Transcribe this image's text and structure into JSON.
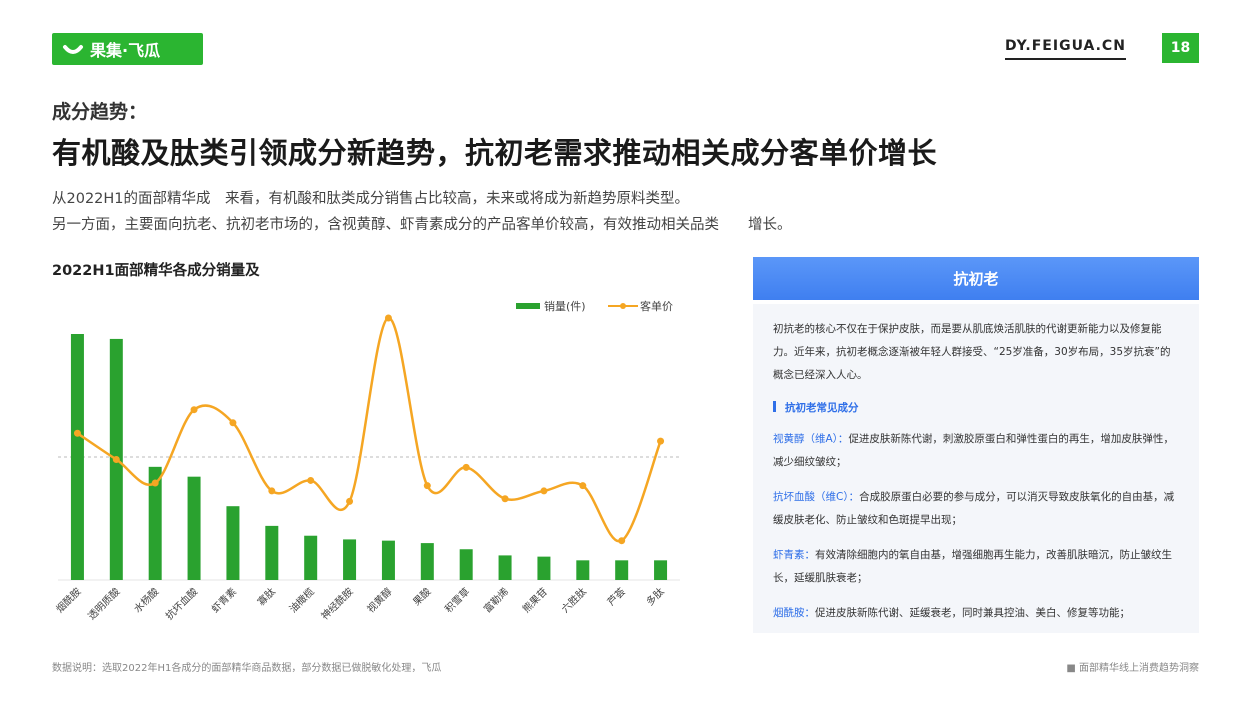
{
  "header": {
    "logo_text": "果集·飞瓜",
    "site": "DY.FEIGUA.CN",
    "page_number": "18"
  },
  "kicker": "成分趋势：",
  "headline": "有机酸及肽类引领成分新趋势，抗初老需求推动相关成分客单价增长",
  "description": [
    "从2022H1的面部精华成　来看，有机酸和肽类成分销售占比较高，未来或将成为新趋势原料类型。",
    "另一方面，主要面向抗老、抗初老市场的，含视黄醇、虾青素成分的产品客单价较高，有效推动相关品类　　增长。"
  ],
  "chart_data": {
    "type": "bar",
    "title": "2022H1面部精华各成分销量及",
    "categories": [
      "烟酰胺",
      "透明质酸",
      "水杨酸",
      "抗坏血酸",
      "虾青素",
      "寡肽",
      "油橄榄",
      "神经酰胺",
      "视黄醇",
      "果酸",
      "积雪草",
      "富勒烯",
      "熊果苷",
      "六胜肽",
      "芦荟",
      "多肽"
    ],
    "series": [
      {
        "name": "销量(件)",
        "type": "bar",
        "values": [
          100,
          98,
          46,
          42,
          30,
          22,
          18,
          16.5,
          16,
          15,
          12.5,
          10,
          9.5,
          8,
          8,
          8
        ]
      },
      {
        "name": "客单价",
        "type": "line",
        "values": [
          56,
          46,
          37,
          65,
          60,
          34,
          38,
          30,
          100,
          36,
          43,
          31,
          34,
          36,
          15,
          53
        ]
      }
    ],
    "ylim": [
      0,
      100
    ],
    "reference_line": 50,
    "colors": {
      "bar": "#2aa22f",
      "line": "#f5a623"
    },
    "legend_position": "top-right",
    "grid": false
  },
  "panel": {
    "title": "抗初老",
    "intro": "初抗老的核心不仅在于保护皮肤，而是要从肌底焕活肌肤的代谢更新能力以及修复能力。近年来，抗初老概念逐渐被年轻人群接受、“25岁准备，30岁布局，35岁抗衰”的概念已经深入人心。",
    "section_title": "抗初老常见成分",
    "items": [
      {
        "term": "视黄醇（维A）：",
        "text": "促进皮肤新陈代谢，刺激胶原蛋白和弹性蛋白的再生，增加皮肤弹性，减少细纹皱纹；"
      },
      {
        "term": "抗坏血酸（维C）：",
        "text": "合成胶原蛋白必要的参与成分，可以消灭导致皮肤氧化的自由基，减缓皮肤老化、防止皱纹和色斑提早出现；"
      },
      {
        "term": "虾青素：",
        "text": "有效清除细胞内的氧自由基，增强细胞再生能力，改善肌肤暗沉，防止皱纹生长，延缓肌肤衰老；"
      },
      {
        "term": "烟酰胺：",
        "text": "促进皮肤新陈代谢、延缓衰老，同时兼具控油、美白、修复等功能；"
      }
    ]
  },
  "footer": {
    "note": "数据说明：选取2022年H1各成分的面部精华商品数据，部分数据已做脱敏化处理，飞瓜",
    "right": "■ 面部精华线上消费趋势洞察"
  }
}
